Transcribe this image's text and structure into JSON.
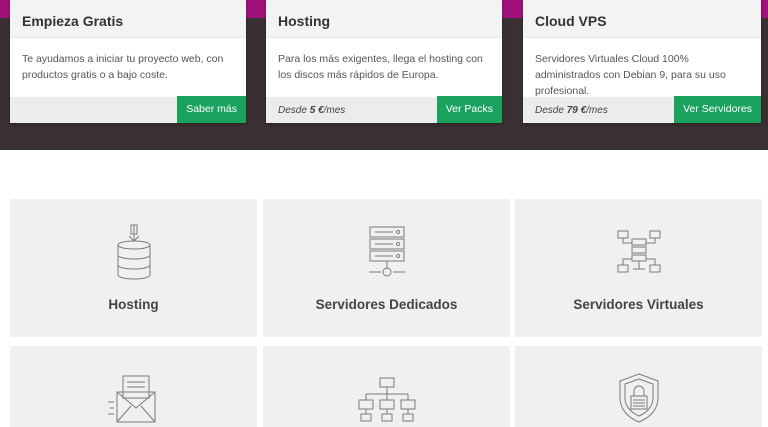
{
  "cards": [
    {
      "title": "Empieza Gratis",
      "text": "Te ayudamos a iniciar tu proyecto web, con productos gratis o a bajo coste.",
      "price_prefix": "",
      "price": "",
      "price_suffix": "",
      "button": "Saber más"
    },
    {
      "title": "Hosting",
      "text": "Para los más exigentes, llega el hosting con los discos más rápidos de Europa.",
      "price_prefix": "Desde ",
      "price": "5 €",
      "price_suffix": "/mes",
      "button": "Ver Packs"
    },
    {
      "title": "Cloud VPS",
      "text": "Servidores Virtuales Cloud 100% administrados con Debian 9, para su uso profesional.",
      "price_prefix": "Desde ",
      "price": "79 €",
      "price_suffix": "/mes",
      "button": "Ver Servidores"
    }
  ],
  "tiles": [
    {
      "label": "Hosting",
      "icon": "database-download-icon"
    },
    {
      "label": "Servidores Dedicados",
      "icon": "server-rack-icon"
    },
    {
      "label": "Servidores Virtuales",
      "icon": "virtual-network-icon"
    },
    {
      "label": "",
      "icon": "email-envelope-icon"
    },
    {
      "label": "",
      "icon": "hierarchy-network-icon"
    },
    {
      "label": "",
      "icon": "security-shield-icon"
    }
  ],
  "colors": {
    "accent_green": "#1aa35f",
    "brand_magenta": "#a0117a",
    "dark_band": "#3a3032"
  }
}
